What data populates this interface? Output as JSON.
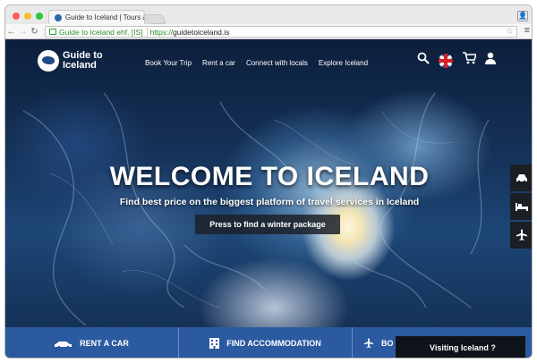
{
  "browser": {
    "tab_title": "Guide to Iceland | Tours &",
    "ev_label": "Guide to Iceland ehf. [IS]",
    "url_scheme": "https://",
    "url_host": "guidetoiceland.is"
  },
  "site": {
    "logo_line1": "Guide to",
    "logo_line2": "Iceland",
    "nav": [
      "Book Your Trip",
      "Rent a car",
      "Connect with locals",
      "Explore Iceland"
    ],
    "hero_title": "WELCOME TO ICELAND",
    "hero_subtitle": "Find best price on the biggest platform of travel services in Iceland",
    "hero_button": "Press to find a winter package",
    "bottom": {
      "rent_car": "RENT A CAR",
      "accommodation": "FIND ACCOMMODATION",
      "third": "BO"
    },
    "chat_label": "Visiting Iceland ?"
  },
  "icons": {
    "side": [
      "car-icon",
      "bed-icon",
      "plane-icon"
    ],
    "nav": [
      "search-icon",
      "uk-flag-icon",
      "cart-icon",
      "user-icon"
    ]
  },
  "colors": {
    "brand_blue": "#2c5aa0",
    "dark_panel": "#1a1f26"
  }
}
